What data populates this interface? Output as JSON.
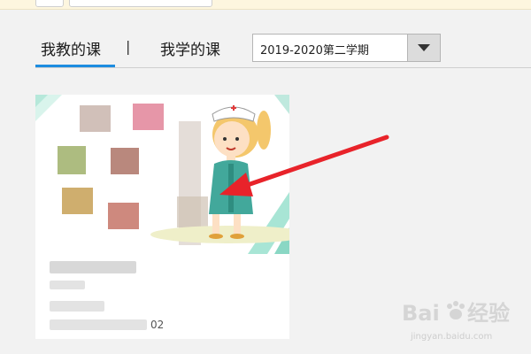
{
  "tabs": [
    {
      "label": "我教的课",
      "active": true
    },
    {
      "label": "我学的课",
      "active": false
    }
  ],
  "separator": "|",
  "term_select": {
    "value": "2019-2020第二学期"
  },
  "course_card": {
    "number_fragment": "02"
  },
  "watermark": {
    "logo_text": "Bai du 经验",
    "url_text": "jingyan.baidu.com"
  },
  "colors": {
    "accent": "#1d8de0",
    "arrow": "#e8232a"
  }
}
